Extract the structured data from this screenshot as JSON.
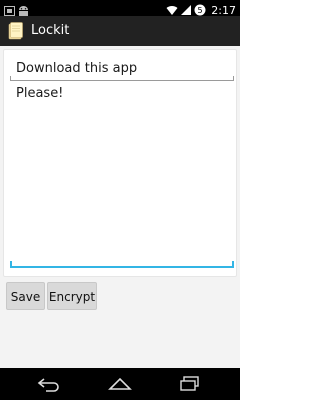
{
  "status_bar": {
    "time": "2:17",
    "icons": [
      "notification-icon",
      "android-icon",
      "wifi-icon",
      "signal-icon",
      "battery-icon"
    ]
  },
  "action_bar": {
    "title": "Lockit",
    "icon": "app-icon"
  },
  "editor": {
    "title_value": "Download this app",
    "body_value": "Please!"
  },
  "buttons": {
    "save_label": "Save",
    "encrypt_label": "Encrypt"
  },
  "nav_bar": {
    "icons": [
      "back-icon",
      "home-icon",
      "recent-apps-icon"
    ]
  },
  "colors": {
    "focus_accent": "#33b5e5",
    "action_bar_bg": "#222222"
  }
}
